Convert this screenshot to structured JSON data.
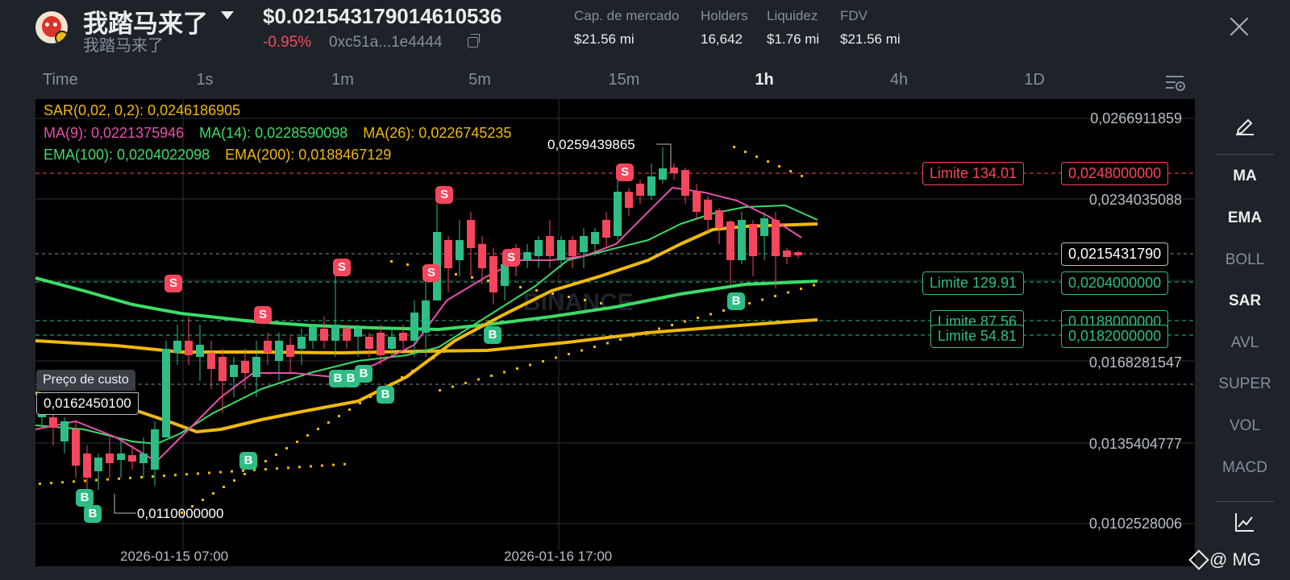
{
  "header": {
    "token_name": "我踏马来了",
    "token_subname": "我踏马来了",
    "price": "$0.021543179014610536",
    "change": "-0.95%",
    "address": "0xc51a...1e4444",
    "stats": [
      {
        "label": "Cap. de mercado",
        "value": "$21.56 mi"
      },
      {
        "label": "Holders",
        "value": "16,642"
      },
      {
        "label": "Liquidez",
        "value": "$1.76 mi"
      },
      {
        "label": "FDV",
        "value": "$21.56 mi"
      }
    ]
  },
  "tabs": [
    "Time",
    "1s",
    "1m",
    "5m",
    "15m",
    "1h",
    "4h",
    "1D"
  ],
  "active_tab": "1h",
  "legend": {
    "sar": "SAR(0,02, 0,2): 0,0246186905",
    "ma9": "MA(9): 0,0221375946",
    "ma14": "MA(14): 0,0228590098",
    "ma26": "MA(26): 0,0226745235",
    "ema100": "EMA(100): 0,0204022098",
    "ema200": "EMA(200): 0,0188467129"
  },
  "price_scale": [
    "0,0266911859",
    "0,0234035088",
    "0,0168281547",
    "0,0135404777",
    "0,0102528006"
  ],
  "current_price": "0,0215431790",
  "limit_orders": [
    {
      "label": "Limite 134.01",
      "price": "0,0248000000",
      "side": "sell"
    },
    {
      "label": "Limite 129.91",
      "price": "0,0204000000",
      "side": "buy"
    },
    {
      "label": "Limite 87.56",
      "price": "0,0188000000",
      "side": "buy"
    },
    {
      "label": "Limite 54.81",
      "price": "0,0182000000",
      "side": "buy"
    }
  ],
  "cost_label": "Preço de custo",
  "cost_value": "0,0162450100",
  "annotations": {
    "high": "0,0259439865",
    "low": "0,0110000000"
  },
  "dates": [
    "2026-01-15 07:00",
    "2026-01-16 17:00"
  ],
  "watermark": "BINANCE",
  "sidebar": [
    "MA",
    "EMA",
    "BOLL",
    "SAR",
    "AVL",
    "SUPER",
    "VOL",
    "MACD"
  ],
  "sidebar_active": [
    "MA",
    "EMA",
    "SAR"
  ],
  "footer": "@ MG",
  "icons": [
    "close-icon",
    "copy-icon",
    "caret-down-icon",
    "chart-settings-icon",
    "pencil-icon",
    "chart-line-icon",
    "binance-icon"
  ],
  "colors": {
    "up": "#2ebd85",
    "down": "#f6465d",
    "sar": "#f0b90b",
    "ma9": "#e84fad",
    "ma14": "#3ddc68",
    "ma26": "#f0b90b",
    "ema100": "#3ddc68",
    "ema200": "#f0b90b"
  }
}
